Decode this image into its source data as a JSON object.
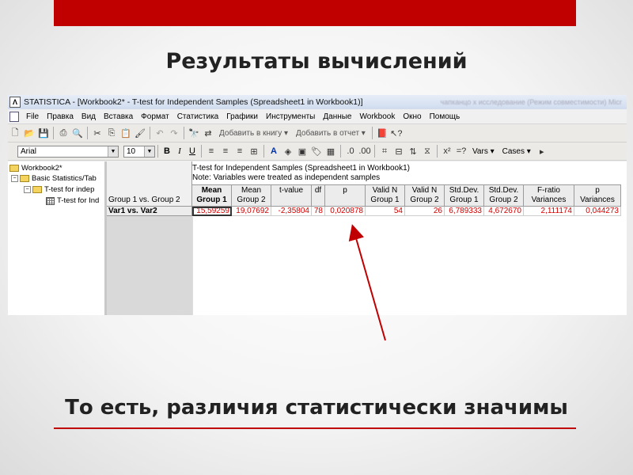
{
  "slide": {
    "title": "Результаты вычислений",
    "bottom_text": "То есть, различия статистически значимы",
    "accent_color": "#c00000"
  },
  "window": {
    "title": "STATISTICA - [Workbook2* - T-test for Independent Samples (Spreadsheet1 in Workbook1)]",
    "title_faded": "чапканцо х исследование (Режим совместимости)   Micr",
    "app_icon": "statistica-icon"
  },
  "menu": [
    "File",
    "Правка",
    "Вид",
    "Вставка",
    "Формат",
    "Статистика",
    "Графики",
    "Инструменты",
    "Данные",
    "Workbook",
    "Окно",
    "Помощь"
  ],
  "toolbar1": {
    "add_to_book": "Добавить в книгу",
    "add_to_report": "Добавить в отчет"
  },
  "toolbar2": {
    "font": "Arial",
    "font_size": "10",
    "bold": "B",
    "italic": "I",
    "underline": "U",
    "vars": "Vars",
    "cases": "Cases"
  },
  "tree": {
    "items": [
      "Workbook2*",
      "Basic Statistics/Tab",
      "T-test for indep",
      "T-test for Ind"
    ]
  },
  "sheet": {
    "note_line1": "T-test for Independent Samples (Spreadsheet1 in Workbook1)",
    "note_line2": "Note: Variables were treated as independent samples",
    "group_label": "Group 1  vs.  Group 2",
    "columns": [
      {
        "l1": "Mean",
        "l2": "Group 1"
      },
      {
        "l1": "Mean",
        "l2": "Group 2"
      },
      {
        "l1": "t-value",
        "l2": ""
      },
      {
        "l1": "df",
        "l2": ""
      },
      {
        "l1": "p",
        "l2": ""
      },
      {
        "l1": "Valid N",
        "l2": "Group 1"
      },
      {
        "l1": "Valid N",
        "l2": "Group 2"
      },
      {
        "l1": "Std.Dev.",
        "l2": "Group 1"
      },
      {
        "l1": "Std.Dev.",
        "l2": "Group 2"
      },
      {
        "l1": "F-ratio",
        "l2": "Variances"
      },
      {
        "l1": "p",
        "l2": "Variances"
      }
    ],
    "row_label": "Var1 vs.      Var2",
    "row_values": [
      "15,59259",
      "19,07692",
      "-2,35804",
      "78",
      "0,020878",
      "54",
      "26",
      "6,789333",
      "4,672670",
      "2,111174",
      "0,044273"
    ]
  }
}
